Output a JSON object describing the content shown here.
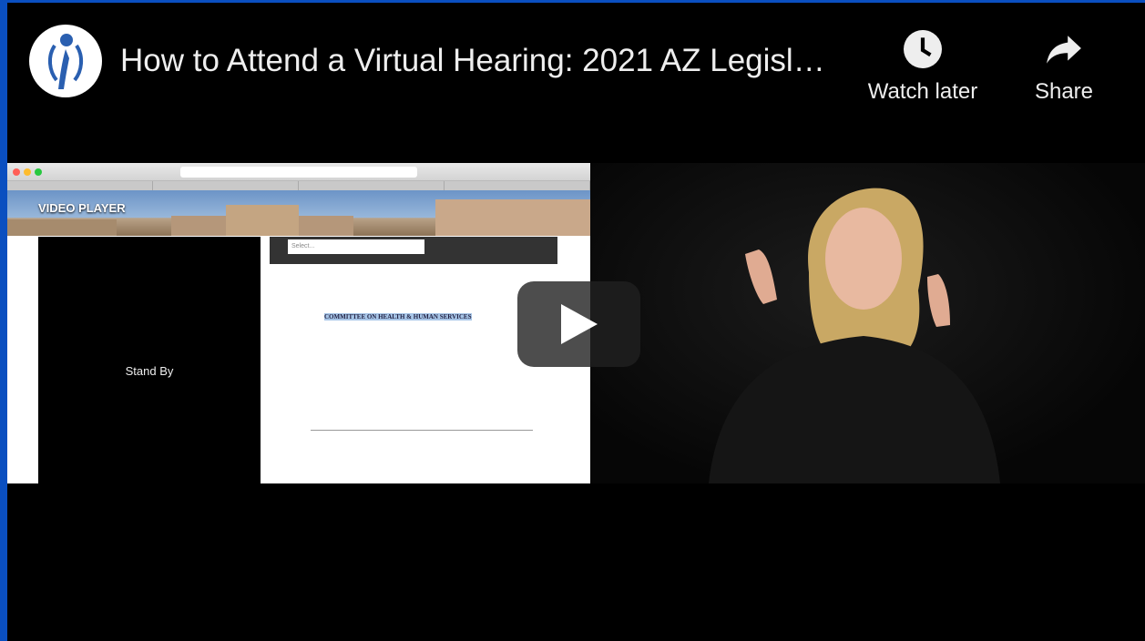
{
  "video": {
    "title": "How to Attend a Virtual Hearing: 2021 AZ Legisl…",
    "actions": {
      "watch_later": "Watch later",
      "share": "Share"
    },
    "logo_icon": "person-figure-logo-icon",
    "play_icon": "play-icon"
  },
  "screen": {
    "banner_label": "VIDEO PLAYER",
    "stand_by": "Stand By",
    "select_placeholder": "Select...",
    "doc_title": "COMMITTEE ON HEALTH & HUMAN SERVICES"
  },
  "colors": {
    "border": "#0a4fc0",
    "background": "#000000",
    "text": "#eeeeee"
  }
}
